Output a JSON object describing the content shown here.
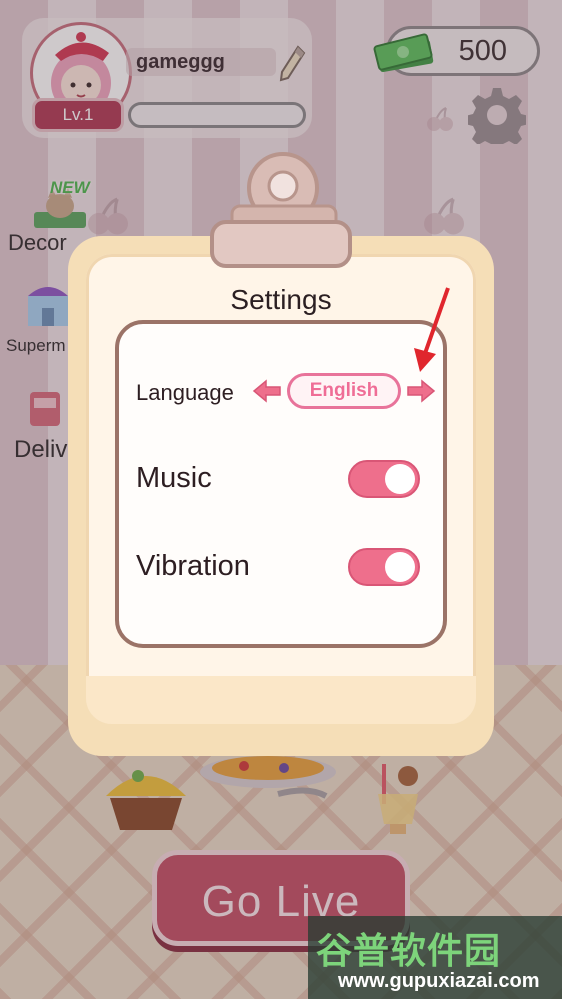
{
  "profile": {
    "username": "gameggg",
    "level": "Lv.1",
    "xp_fraction": 0.0
  },
  "currency": {
    "amount": "500"
  },
  "side_menu": {
    "decor": "Decor",
    "market": "Superm",
    "delivery": "Deliv",
    "new_badge": "NEW"
  },
  "dialog": {
    "title": "Settings",
    "language": {
      "label": "Language",
      "value": "English"
    },
    "music": {
      "label": "Music",
      "on": true
    },
    "vibration": {
      "label": "Vibration",
      "on": true
    }
  },
  "actions": {
    "go_live": "Go Live"
  },
  "watermark": {
    "name": "谷普软件园",
    "url": "www.gupuxiazai.com"
  },
  "colors": {
    "accent": "#ee6f8c",
    "dialog": "#f5deb7",
    "button": "#c44f66"
  }
}
